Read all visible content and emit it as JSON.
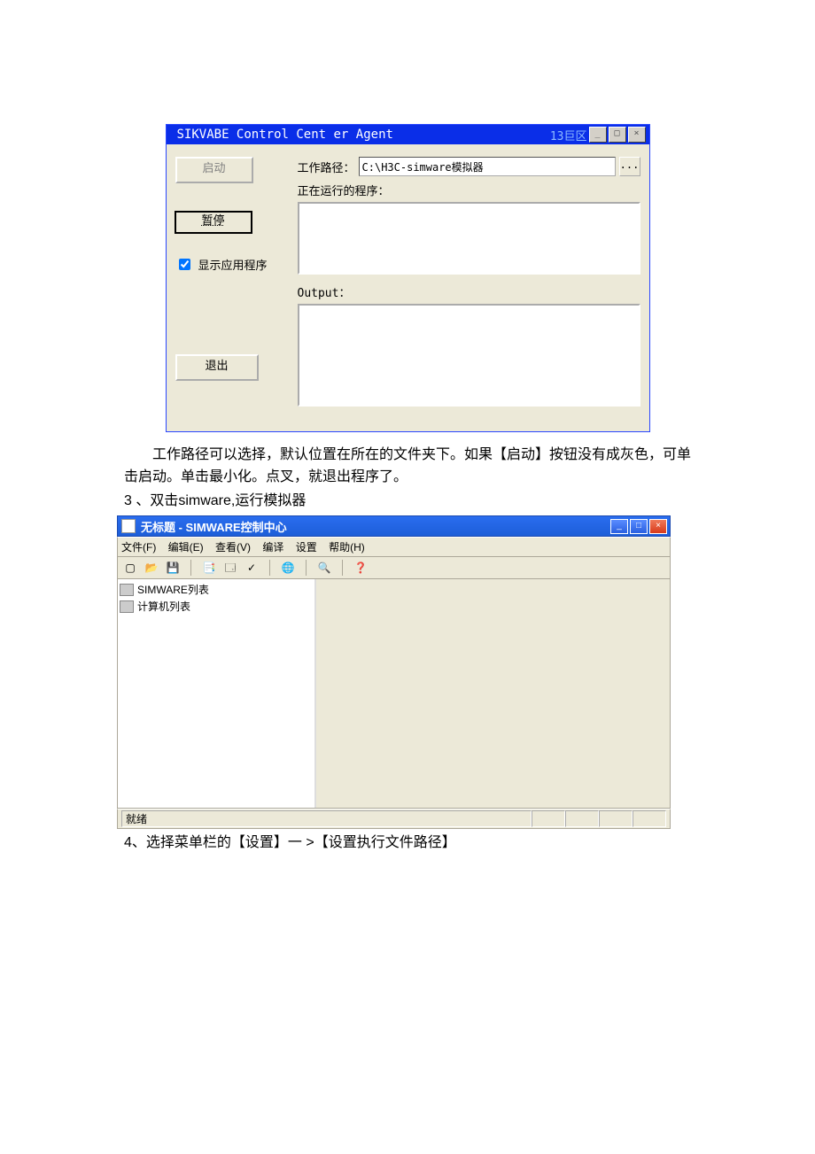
{
  "win1": {
    "title": "SIKVABE Control Cent er Agent",
    "caption_right": "13巨区",
    "btn_start": "启动",
    "btn_pause": "暂停",
    "chk_showapp": "显示应用程序",
    "btn_exit": "退出",
    "workpath_label": "工作路径：",
    "workpath_value": "C:\\H3C-simware模拟器",
    "browse_label": "...",
    "running_label": "正在运行的程序：",
    "output_label": "Output："
  },
  "para1": "工作路径可以选择，默认位置在所在的文件夹下。如果【启动】按钮没有成灰色，可单击启动。单击最小化。点叉，就退出程序了。",
  "para2": "3 、双击simware,运行模拟器",
  "win2": {
    "title": "无标题 - SIMWARE控制中心",
    "menu": {
      "file": "文件(F)",
      "edit": "编辑(E)",
      "view": "查看(V)",
      "compile": "编译",
      "settings": "设置",
      "help": "帮助(H)"
    },
    "tree": {
      "n1": "SIMWARE列表",
      "n2": "计算机列表"
    },
    "status": "就绪"
  },
  "para3": "4、选择菜单栏的【设置】一 >【设置执行文件路径】"
}
